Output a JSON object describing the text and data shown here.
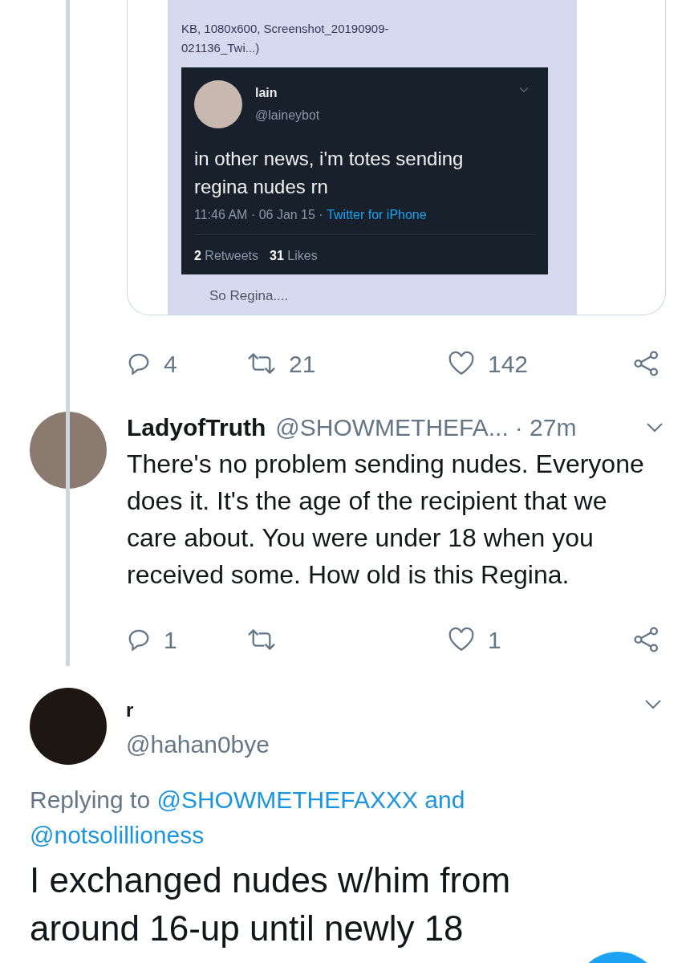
{
  "quoted_card": {
    "file_info": "KB, 1080x600, Screenshot_20190909-021136_Twi...)",
    "embedded_tweet": {
      "name": "lain",
      "handle": "@laineybot",
      "text": "in other news, i'm totes sending regina nudes rn",
      "time": "11:46 AM · 06 Jan 15 · ",
      "source": "Twitter for iPhone",
      "retweets": "2",
      "retweets_label": "Retweets",
      "likes": "31",
      "likes_label": "Likes"
    },
    "caption": "So Regina...."
  },
  "first_actions": {
    "replies": "4",
    "retweets": "21",
    "likes": "142"
  },
  "reply": {
    "name": "LadyofTruth",
    "handle": "@SHOWMETHEFA...",
    "time": "· 27m",
    "text": "There's no problem sending nudes. Everyone does it. It's the age of the recipient that we care about. You were under 18 when you received some. How old is this Regina.",
    "actions": {
      "replies": "1",
      "likes": "1"
    }
  },
  "main_tweet": {
    "name": "r",
    "handle": "@hahan0bye",
    "replying_prefix": "Replying to",
    "mentions": [
      "@SHOWMETHEFAXXX",
      "@notsolillioness"
    ],
    "joiner": "and",
    "text": "I exchanged nudes w/him from around 16-up until newly 18"
  }
}
